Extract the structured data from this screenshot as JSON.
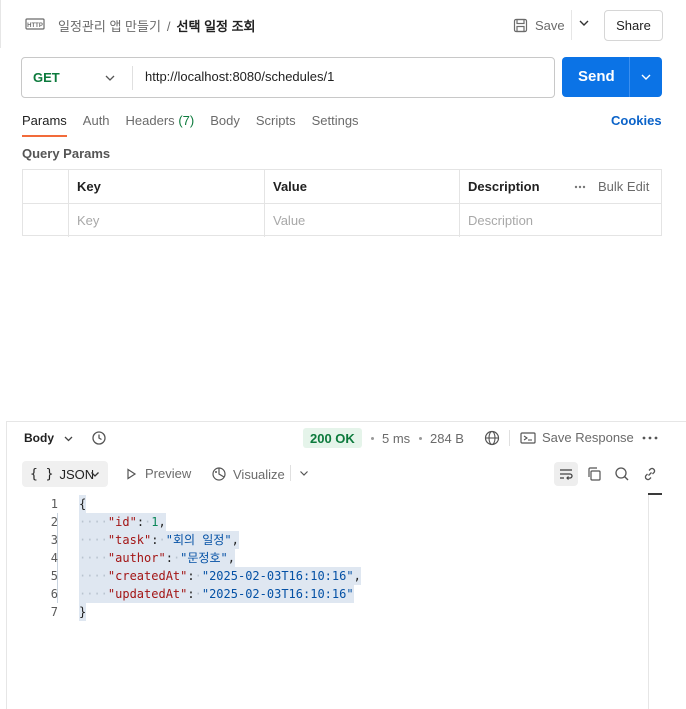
{
  "header": {
    "breadcrumb_parent": "일정관리 앱 만들기",
    "breadcrumb_separator": "/",
    "breadcrumb_current": "선택 일정 조회",
    "save_label": "Save",
    "share_label": "Share",
    "icons": {
      "request": "http-icon",
      "save": "save-icon",
      "save_menu": "chevron-down-icon"
    }
  },
  "request": {
    "method": "GET",
    "url": "http://localhost:8080/schedules/1",
    "send_label": "Send",
    "method_color": "#0c7a3c",
    "send_color": "#0b73e6"
  },
  "tabs": [
    {
      "label": "Params",
      "active": true
    },
    {
      "label": "Auth"
    },
    {
      "label": "Headers",
      "count": "(7)"
    },
    {
      "label": "Body"
    },
    {
      "label": "Scripts"
    },
    {
      "label": "Settings"
    }
  ],
  "cookies_label": "Cookies",
  "query_params": {
    "title": "Query Params",
    "columns": [
      "Key",
      "Value",
      "Description"
    ],
    "bulk_edit_label": "Bulk Edit",
    "placeholders": {
      "key": "Key",
      "value": "Value",
      "description": "Description"
    }
  },
  "response": {
    "body_label": "Body",
    "status": "200 OK",
    "time": "5 ms",
    "size": "284 B",
    "save_response_label": "Save Response",
    "format": "JSON",
    "format_braces": "{ }",
    "preview_label": "Preview",
    "visualize_label": "Visualize",
    "status_color": "#0c7a3c",
    "icons": [
      "history-icon",
      "globe-icon",
      "save-response-icon",
      "more-icon",
      "wrap-icon",
      "copy-icon",
      "search-icon",
      "link-icon"
    ],
    "lines": [
      {
        "n": "1",
        "parts": [
          [
            "punct",
            "{"
          ]
        ]
      },
      {
        "n": "2",
        "parts": [
          [
            "dots",
            "····"
          ],
          [
            "key",
            "\"id\""
          ],
          [
            "punct",
            ":"
          ],
          [
            "dots",
            "·"
          ],
          [
            "num",
            "1"
          ],
          [
            "punct",
            ","
          ]
        ]
      },
      {
        "n": "3",
        "parts": [
          [
            "dots",
            "····"
          ],
          [
            "key",
            "\"task\""
          ],
          [
            "punct",
            ":"
          ],
          [
            "dots",
            "·"
          ],
          [
            "str",
            "\"회의 일정\""
          ],
          [
            "punct",
            ","
          ]
        ]
      },
      {
        "n": "4",
        "parts": [
          [
            "dots",
            "····"
          ],
          [
            "key",
            "\"author\""
          ],
          [
            "punct",
            ":"
          ],
          [
            "dots",
            "·"
          ],
          [
            "str",
            "\"문정호\""
          ],
          [
            "punct",
            ","
          ]
        ]
      },
      {
        "n": "5",
        "parts": [
          [
            "dots",
            "····"
          ],
          [
            "key",
            "\"createdAt\""
          ],
          [
            "punct",
            ":"
          ],
          [
            "dots",
            "·"
          ],
          [
            "str",
            "\"2025-02-03T16:10:16\""
          ],
          [
            "punct",
            ","
          ]
        ]
      },
      {
        "n": "6",
        "parts": [
          [
            "dots",
            "····"
          ],
          [
            "key",
            "\"updatedAt\""
          ],
          [
            "punct",
            ":"
          ],
          [
            "dots",
            "·"
          ],
          [
            "str",
            "\"2025-02-03T16:10:16\""
          ]
        ]
      },
      {
        "n": "7",
        "parts": [
          [
            "punct",
            "}"
          ]
        ]
      }
    ]
  }
}
